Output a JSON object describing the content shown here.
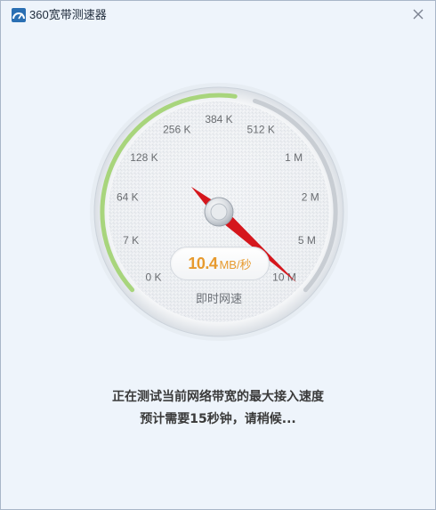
{
  "window": {
    "title": "360宽带测速器",
    "close_icon": "close-icon"
  },
  "gauge": {
    "scale_labels": [
      "0 K",
      "7 K",
      "64 K",
      "128 K",
      "256 K",
      "384 K",
      "512 K",
      "1 M",
      "2 M",
      "5 M",
      "10 M"
    ],
    "needle_position_fraction": 0.99,
    "readout_value": "10.4",
    "readout_unit": "MB/秒",
    "caption": "即时网速",
    "accent_color": "#a8d57c",
    "needle_color": "#d5161c",
    "readout_color": "#e79a2e"
  },
  "status": {
    "line1": "正在测试当前网络带宽的最大接入速度",
    "line2": "预计需要15秒钟，请稍候..."
  }
}
